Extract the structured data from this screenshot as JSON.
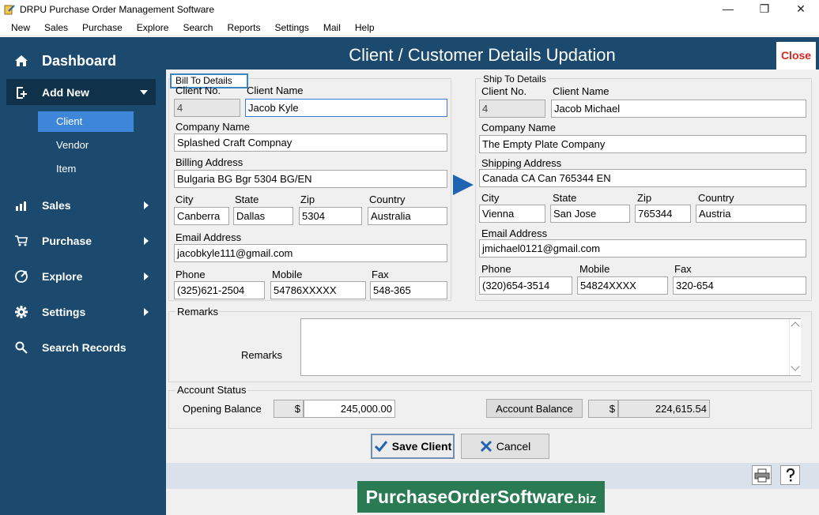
{
  "window": {
    "title": "DRPU Purchase Order Management Software",
    "controls": {
      "minimize": "—",
      "restore": "❐",
      "close": "✕"
    }
  },
  "menu": [
    "New",
    "Sales",
    "Purchase",
    "Explore",
    "Search",
    "Reports",
    "Settings",
    "Mail",
    "Help"
  ],
  "sidebar": {
    "dashboard": "Dashboard",
    "add_new": "Add New",
    "sub_items": [
      "Client",
      "Vendor",
      "Item"
    ],
    "active_sub": "Client",
    "items": [
      {
        "label": "Sales",
        "icon": "bar-chart-icon"
      },
      {
        "label": "Purchase",
        "icon": "cart-icon"
      },
      {
        "label": "Explore",
        "icon": "explore-icon"
      },
      {
        "label": "Settings",
        "icon": "gear-icon"
      },
      {
        "label": "Search Records",
        "icon": "search-icon"
      }
    ]
  },
  "header": {
    "title": "Client / Customer Details Updation",
    "close": "Close"
  },
  "bill_to": {
    "legend": "Bill To Details",
    "labels": {
      "client_no": "Client No.",
      "client_name": "Client Name",
      "company": "Company Name",
      "address": "Billing Address",
      "city": "City",
      "state": "State",
      "zip": "Zip",
      "country": "Country",
      "email": "Email Address",
      "phone": "Phone",
      "mobile": "Mobile",
      "fax": "Fax"
    },
    "values": {
      "client_no": "4",
      "client_name": "Jacob Kyle",
      "company": "Splashed Craft Compnay",
      "address": "Bulgaria BG Bgr 5304 BG/EN",
      "city": "Canberra",
      "state": "Dallas",
      "zip": "5304",
      "country": "Australia",
      "email": "jacobkyle111@gmail.com",
      "phone": "(325)621-2504",
      "mobile": "54786XXXXX",
      "fax": "548-365"
    }
  },
  "ship_to": {
    "legend": "Ship To Details",
    "labels": {
      "client_no": "Client No.",
      "client_name": "Client Name",
      "company": "Company Name",
      "address": "Shipping Address",
      "city": "City",
      "state": "State",
      "zip": "Zip",
      "country": "Country",
      "email": "Email Address",
      "phone": "Phone",
      "mobile": "Mobile",
      "fax": "Fax"
    },
    "values": {
      "client_no": "4",
      "client_name": "Jacob Michael",
      "company": "The Empty Plate Company",
      "address": "Canada CA Can 765344 EN",
      "city": "Vienna",
      "state": "San Jose",
      "zip": "765344",
      "country": "Austria",
      "email": "jmichael0121@gmail.com",
      "phone": "(320)654-3514",
      "mobile": "54824XXXX",
      "fax": "320-654"
    }
  },
  "remarks": {
    "group": "Remarks",
    "label": "Remarks",
    "value": ""
  },
  "account": {
    "group": "Account Status",
    "opening_label": "Opening Balance",
    "currency": "$",
    "opening_value": "245,000.00",
    "balance_button": "Account Balance",
    "balance_value": "224,615.54"
  },
  "buttons": {
    "save": "Save Client",
    "cancel": "Cancel"
  },
  "footer_icons": [
    "printer-icon",
    "help-icon"
  ],
  "watermark": {
    "main": "PurchaseOrderSoftware",
    "suffix": ".biz"
  }
}
